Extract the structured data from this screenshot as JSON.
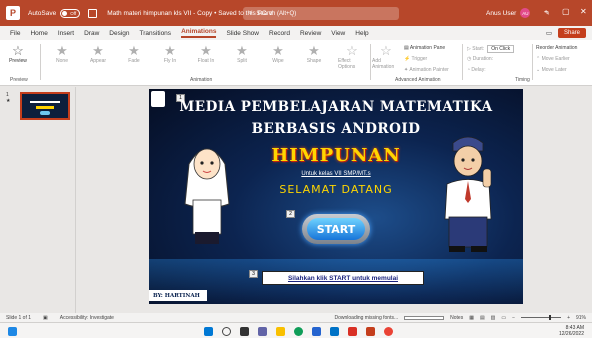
{
  "titlebar": {
    "app_logo": "P",
    "autosave_label": "AutoSave",
    "autosave_state": "Off",
    "doc_title": "Math materi himpunan kls VII - Copy • Saved to this PC ∨",
    "search_placeholder": "Search (Alt+Q)",
    "user_name": "Anus User",
    "user_initials": "AU",
    "minimize": "–",
    "maximize": "▢",
    "close": "✕"
  },
  "menu": {
    "items": [
      "File",
      "Home",
      "Insert",
      "Draw",
      "Design",
      "Transitions",
      "Animations",
      "Slide Show",
      "Record",
      "Review",
      "View",
      "Help"
    ],
    "active": "Animations",
    "share_label": "Share"
  },
  "ribbon": {
    "preview_label": "Preview",
    "preview_group": "Preview",
    "animations": [
      "None",
      "Appear",
      "Fade",
      "Fly In",
      "Float In",
      "Split",
      "Wipe",
      "Shape"
    ],
    "effect_options": "Effect Options",
    "animation_group": "Animation",
    "add_animation": "Add Animation",
    "animation_pane": "Animation Pane",
    "trigger": "Trigger",
    "animation_painter": "Animation Painter",
    "advanced_group": "Advanced Animation",
    "start_label": "Start:",
    "start_value": "On Click",
    "duration_label": "Duration:",
    "delay_label": "Delay:",
    "timing_group": "Timing",
    "reorder_title": "Reorder Animation",
    "move_earlier": "Move Earlier",
    "move_later": "Move Later"
  },
  "thumbs": {
    "number": "1",
    "star": "★"
  },
  "slide": {
    "title_line1": "MEDIA PEMBELAJARAN MATEMATIKA",
    "title_line2": "BERBASIS ANDROID",
    "subject": "HIMPUNAN",
    "class_line": "Untuk kelas VII SMP/MT.s",
    "welcome": "SELAMAT DATANG",
    "start_button": "START",
    "instruction": "Silahkan klik START untuk memulai",
    "credit": "BY: HARTINAH",
    "anim_tags": [
      "1",
      "2",
      "3"
    ]
  },
  "status": {
    "slide_info": "Slide 1 of 1",
    "accessibility": "Accessibility: Investigate",
    "downloading": "Downloading missing fonts...",
    "notes": "Notes",
    "zoom": "91%"
  },
  "taskbar": {
    "time": "8:43 AM",
    "date": "12/26/2022"
  },
  "colors": {
    "accent": "#b7472a",
    "slide_bg": "#0c2450",
    "himpunan": "#ffd600",
    "start": "#1775d9"
  }
}
